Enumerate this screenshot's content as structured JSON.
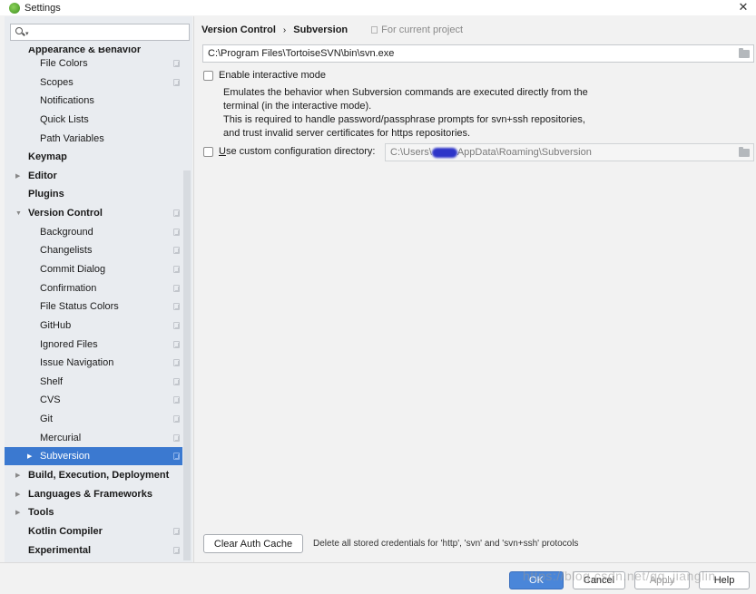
{
  "window": {
    "title": "Settings",
    "close_glyph": "✕"
  },
  "sidebar": {
    "search_placeholder": "",
    "items": [
      {
        "label": "Appearance & Behavior",
        "level": 0,
        "bold": true,
        "arrow": "",
        "page_icon": false
      },
      {
        "label": "File Colors",
        "level": 1,
        "bold": false,
        "arrow": "",
        "page_icon": true
      },
      {
        "label": "Scopes",
        "level": 1,
        "bold": false,
        "arrow": "",
        "page_icon": true
      },
      {
        "label": "Notifications",
        "level": 1,
        "bold": false,
        "arrow": "",
        "page_icon": false
      },
      {
        "label": "Quick Lists",
        "level": 1,
        "bold": false,
        "arrow": "",
        "page_icon": false
      },
      {
        "label": "Path Variables",
        "level": 1,
        "bold": false,
        "arrow": "",
        "page_icon": false
      },
      {
        "label": "Keymap",
        "level": 0,
        "bold": true,
        "arrow": "",
        "page_icon": false
      },
      {
        "label": "Editor",
        "level": 0,
        "bold": true,
        "arrow": "▶",
        "page_icon": false
      },
      {
        "label": "Plugins",
        "level": 0,
        "bold": true,
        "arrow": "",
        "page_icon": false
      },
      {
        "label": "Version Control",
        "level": 0,
        "bold": true,
        "arrow": "▼",
        "page_icon": true
      },
      {
        "label": "Background",
        "level": 1,
        "bold": false,
        "arrow": "",
        "page_icon": true
      },
      {
        "label": "Changelists",
        "level": 1,
        "bold": false,
        "arrow": "",
        "page_icon": true
      },
      {
        "label": "Commit Dialog",
        "level": 1,
        "bold": false,
        "arrow": "",
        "page_icon": true
      },
      {
        "label": "Confirmation",
        "level": 1,
        "bold": false,
        "arrow": "",
        "page_icon": true
      },
      {
        "label": "File Status Colors",
        "level": 1,
        "bold": false,
        "arrow": "",
        "page_icon": true
      },
      {
        "label": "GitHub",
        "level": 1,
        "bold": false,
        "arrow": "",
        "page_icon": true
      },
      {
        "label": "Ignored Files",
        "level": 1,
        "bold": false,
        "arrow": "",
        "page_icon": true
      },
      {
        "label": "Issue Navigation",
        "level": 1,
        "bold": false,
        "arrow": "",
        "page_icon": true
      },
      {
        "label": "Shelf",
        "level": 1,
        "bold": false,
        "arrow": "",
        "page_icon": true
      },
      {
        "label": "CVS",
        "level": 1,
        "bold": false,
        "arrow": "",
        "page_icon": true
      },
      {
        "label": "Git",
        "level": 1,
        "bold": false,
        "arrow": "",
        "page_icon": true
      },
      {
        "label": "Mercurial",
        "level": 1,
        "bold": false,
        "arrow": "",
        "page_icon": true
      },
      {
        "label": "Subversion",
        "level": 1,
        "bold": false,
        "arrow": "▶",
        "page_icon": true,
        "selected": true
      },
      {
        "label": "Build, Execution, Deployment",
        "level": 0,
        "bold": true,
        "arrow": "▶",
        "page_icon": false
      },
      {
        "label": "Languages & Frameworks",
        "level": 0,
        "bold": true,
        "arrow": "▶",
        "page_icon": false
      },
      {
        "label": "Tools",
        "level": 0,
        "bold": true,
        "arrow": "▶",
        "page_icon": false
      },
      {
        "label": "Kotlin Compiler",
        "level": 0,
        "bold": true,
        "arrow": "",
        "page_icon": true
      },
      {
        "label": "Experimental",
        "level": 0,
        "bold": true,
        "arrow": "",
        "page_icon": true
      }
    ]
  },
  "main": {
    "breadcrumb": {
      "parent": "Version Control",
      "separator": "›",
      "current": "Subversion",
      "scope": "For current project"
    },
    "svn_path": "C:\\Program Files\\TortoiseSVN\\bin\\svn.exe",
    "interactive_mode": {
      "label": "Enable interactive mode",
      "checked": false,
      "description": [
        "Emulates the behavior when Subversion commands are executed directly from the",
        "terminal (in the interactive mode).",
        "This is required to handle password/passphrase prompts for svn+ssh repositories,",
        "and trust invalid server certificates for https repositories."
      ]
    },
    "custom_config": {
      "label_mnemonic": "U",
      "label_rest": "se custom configuration directory:",
      "checked": false,
      "path_prefix": "C:\\Users\\",
      "path_suffix": "AppData\\Roaming\\Subversion"
    },
    "clear_auth_cache": {
      "button_label": "Clear Auth Cache",
      "note": "Delete all stored credentials for 'http', 'svn' and 'svn+ssh' protocols"
    }
  },
  "footer": {
    "ok_label": "OK",
    "cancel_label": "Cancel",
    "apply_label": "Apply",
    "help_label": "Help",
    "watermark": "https://blog.csdn.net/qq_jianglin"
  },
  "colors": {
    "selection": "#3b79d0",
    "ok_button": "#4a86d9",
    "sidebar_bg": "#e9ecf0"
  }
}
